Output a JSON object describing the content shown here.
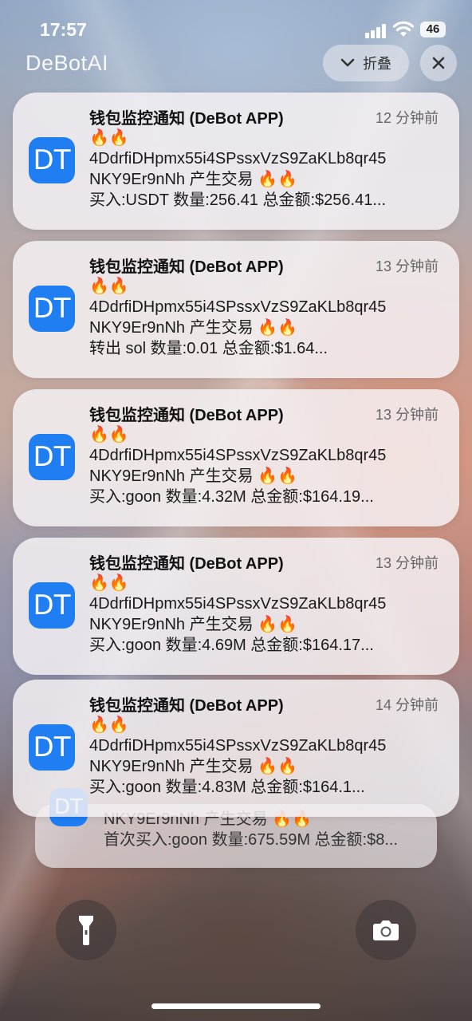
{
  "status": {
    "time": "17:57",
    "battery": "46"
  },
  "app_label": "DeBotAI",
  "collapse_label": "折叠",
  "notifications": [
    {
      "title": "钱包监控通知 (DeBot APP)",
      "time": "12 分钟前",
      "line1": "🔥🔥",
      "line2": "4DdrfiDHpmx55i4SPssxVzS9ZaKLb8qr45",
      "line3": "NKY9Er9nNh 产生交易 🔥🔥",
      "line4": "买入:USDT 数量:256.41 总金额:$256.41..."
    },
    {
      "title": "钱包监控通知 (DeBot APP)",
      "time": "13 分钟前",
      "line1": "🔥🔥",
      "line2": "4DdrfiDHpmx55i4SPssxVzS9ZaKLb8qr45",
      "line3": "NKY9Er9nNh 产生交易 🔥🔥",
      "line4": "转出 sol 数量:0.01 总金额:$1.64..."
    },
    {
      "title": "钱包监控通知 (DeBot APP)",
      "time": "13 分钟前",
      "line1": "🔥🔥",
      "line2": "4DdrfiDHpmx55i4SPssxVzS9ZaKLb8qr45",
      "line3": "NKY9Er9nNh 产生交易 🔥🔥",
      "line4": "买入:goon 数量:4.32M 总金额:$164.19..."
    },
    {
      "title": "钱包监控通知 (DeBot APP)",
      "time": "13 分钟前",
      "line1": "🔥🔥",
      "line2": "4DdrfiDHpmx55i4SPssxVzS9ZaKLb8qr45",
      "line3": "NKY9Er9nNh 产生交易 🔥🔥",
      "line4": "买入:goon 数量:4.69M 总金额:$164.17..."
    },
    {
      "title": "钱包监控通知 (DeBot APP)",
      "time": "14 分钟前",
      "line1": "🔥🔥",
      "line2": "4DdrfiDHpmx55i4SPssxVzS9ZaKLb8qr45",
      "line3": "NKY9Er9nNh 产生交易 🔥🔥",
      "line4": "买入:goon 数量:4.83M 总金额:$164.1..."
    }
  ],
  "stacked_notification": {
    "line1": "NKY9Er9nNh 产生交易 🔥🔥",
    "line2": "首次买入:goon 数量:675.59M 总金额:$8..."
  },
  "app_icon_text": "DT",
  "icons": {
    "collapse": "chevron-down-icon",
    "close": "close-icon",
    "flashlight": "flashlight-icon",
    "camera": "camera-icon",
    "signal": "cellular-signal-icon",
    "wifi": "wifi-icon",
    "battery": "battery-icon"
  }
}
